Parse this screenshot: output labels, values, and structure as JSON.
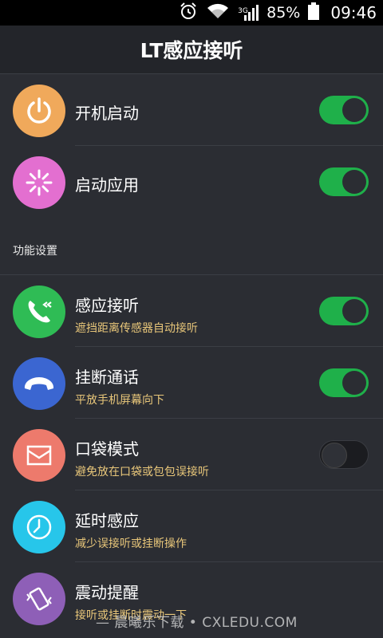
{
  "status_bar": {
    "network_label": "3G",
    "battery": "85%",
    "time": "09:46"
  },
  "header": {
    "title": "LT感应接听"
  },
  "top_items": [
    {
      "label": "开机启动",
      "icon": "power-icon",
      "color": "#f0a95b",
      "enabled": true
    },
    {
      "label": "启动应用",
      "icon": "loading-spinner-icon",
      "color": "#e36fd0",
      "enabled": true
    }
  ],
  "section": {
    "title": "功能设置"
  },
  "feature_items": [
    {
      "label": "感应接听",
      "sub": "遮挡距离传感器自动接听",
      "icon": "incoming-call-icon",
      "color": "#2fbc55",
      "enabled": true
    },
    {
      "label": "挂断通话",
      "sub": "平放手机屏幕向下",
      "icon": "hang-up-icon",
      "color": "#3b66d1",
      "enabled": true
    },
    {
      "label": "口袋模式",
      "sub": "避免放在口袋或包包误接听",
      "icon": "envelope-icon",
      "color": "#ed7a6c",
      "enabled": false
    },
    {
      "label": "延时感应",
      "sub": "减少误接听或挂断操作",
      "icon": "clock-icon",
      "color": "#27c6ea",
      "enabled": null
    },
    {
      "label": "震动提醒",
      "sub": "接听或挂断时震动一下",
      "icon": "vibrate-phone-icon",
      "color": "#8e5fb7",
      "enabled": null
    }
  ],
  "watermark": "— 晨曦乐下载 • CXLEDU.COM"
}
